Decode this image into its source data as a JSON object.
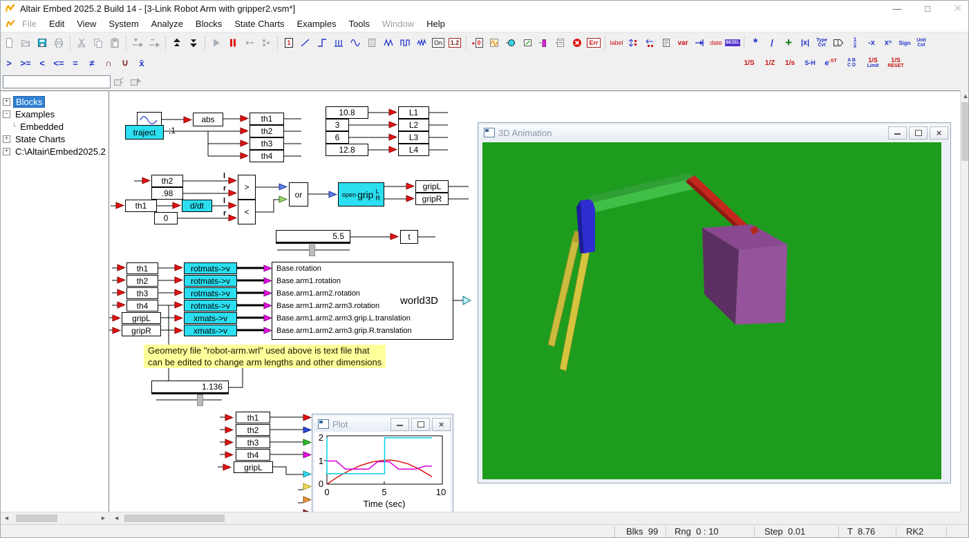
{
  "window": {
    "title": "Altair Embed  2025.2 Build 14 - [3-Link Robot Arm with gripper2.vsm*]"
  },
  "menu": [
    "File",
    "Edit",
    "View",
    "System",
    "Analyze",
    "Blocks",
    "State Charts",
    "Examples",
    "Tools",
    "Window",
    "Help"
  ],
  "tb": {
    "c1": "1",
    "on": "On",
    "sl": "1.2",
    "d0": "0",
    "err": "Err",
    "label": "label",
    "var": "var",
    "date": "date",
    "bezel": "BEZEL",
    "mul": "*",
    "div": "/",
    "add": "+",
    "abs": "|x|",
    "tc1": "Type",
    "tc2": "Cvt",
    "gain": "1",
    "rc1": "1",
    "rc2": "x",
    "neg": "-x",
    "pow": "xⁿ",
    "sign": "Sign",
    "uc1": "Unit",
    "uc2": "Cvt",
    "gt": ">",
    "gte": ">=",
    "lt": "<",
    "lte": "<=",
    "eq": "=",
    "neq": "≠",
    "cap": "∩",
    "cup": "∪",
    "xbar": "x̄",
    "is": "1/S",
    "iz": "1/Z",
    "is2": "1/s",
    "sh": "S-H",
    "e": "e",
    "est": "-ST",
    "ab": "A B",
    "cd": "C D",
    "lim1": "1/S",
    "lim2": "Limit",
    "rst1": "1/S",
    "rst2": "RESET"
  },
  "tree": {
    "search_value": "",
    "items": [
      "Blocks",
      "Examples",
      "Embedded",
      "State Charts",
      "C:\\Altair\\Embed2025.2"
    ]
  },
  "labels": {
    "traject": "traject",
    "abs": "abs",
    "th1": "th1",
    "th2": "th2",
    "th3": "th3",
    "th4": "th4",
    "L1": "L1",
    "L2": "L2",
    "L3": "L3",
    "L4": "L4",
    "ddt": "d/dt",
    "gt": ">",
    "lt": "<",
    "l": "l",
    "r": "r",
    "or": "or",
    "open": "open",
    "grip": "grip",
    "L": "L",
    "R": "R",
    "gripL": "gripL",
    "gripR": "gripR",
    "t": "t",
    "rotmat": "rotmats->v",
    "xmat": "xmats->v",
    "world3d": "world3D",
    "wire_tag": ";1"
  },
  "constants": {
    "c1": "10.8",
    "c2": "3",
    "c3": "6",
    "c4": "12.8",
    "c98": ".98",
    "c0": "0",
    "slider_t": "5.5",
    "slider_geom": "1.136"
  },
  "w3d": [
    "Base.rotation",
    "Base.arm1.rotation",
    "Base.arm1.arm2.rotation",
    "Base.arm1.arm2.arm3.rotation",
    "Base.arm1.arm2.arm3.grip.L.translation",
    "Base.arm1.arm2.arm3.grip.R.translation"
  ],
  "note": {
    "line1": "Geometry file \"robot-arm.wrl\" used above is text file that",
    "line2": "can be edited to change arm lengths and other dimensions"
  },
  "plot_window": {
    "title": "Plot"
  },
  "anim_window": {
    "title": "3D Animation"
  },
  "status": {
    "blks_l": "Blks",
    "blks_v": "99",
    "rng_l": "Rng",
    "rng_v": "0 : 10",
    "step_l": "Step",
    "step_v": "0.01",
    "t_l": "T",
    "t_v": "8.76",
    "rk": "RK2"
  },
  "chart_data": {
    "type": "line",
    "title": "Plot",
    "xlabel": "Time (sec)",
    "xlim": [
      0,
      10
    ],
    "ylim": [
      0,
      2
    ],
    "xticks": [
      0,
      5,
      10
    ],
    "yticks": [
      0,
      1,
      2
    ],
    "xtick_labels": [
      "0",
      "5",
      "10"
    ],
    "ytick_labels": [
      "2",
      "1",
      "0"
    ],
    "legend_position": "none",
    "grid": false,
    "series": [
      {
        "name": "th1",
        "color": "#DC1414",
        "points": [
          [
            0,
            0
          ],
          [
            1,
            0.33
          ],
          [
            2,
            0.6
          ],
          [
            3,
            0.82
          ],
          [
            4,
            0.97
          ],
          [
            5,
            1.03
          ],
          [
            5.5,
            1.04
          ],
          [
            6,
            1.01
          ],
          [
            7,
            0.88
          ],
          [
            8,
            0.65
          ],
          [
            9.1,
            0.32
          ]
        ]
      },
      {
        "name": "th4",
        "color": "#D800D8",
        "points": [
          [
            0,
            1
          ],
          [
            0.8,
            1
          ],
          [
            1.6,
            0.65
          ],
          [
            3.6,
            0.65
          ],
          [
            4.4,
            0.97
          ],
          [
            5.4,
            0.97
          ],
          [
            6.2,
            0.65
          ],
          [
            7.7,
            0.65
          ],
          [
            8.5,
            0.78
          ],
          [
            9.1,
            0.78
          ]
        ]
      },
      {
        "name": "gripL",
        "color": "#00D0E4",
        "points": [
          [
            0,
            2
          ],
          [
            0,
            0.45
          ],
          [
            5,
            0.45
          ],
          [
            5,
            2
          ],
          [
            9.1,
            2
          ]
        ]
      }
    ]
  }
}
